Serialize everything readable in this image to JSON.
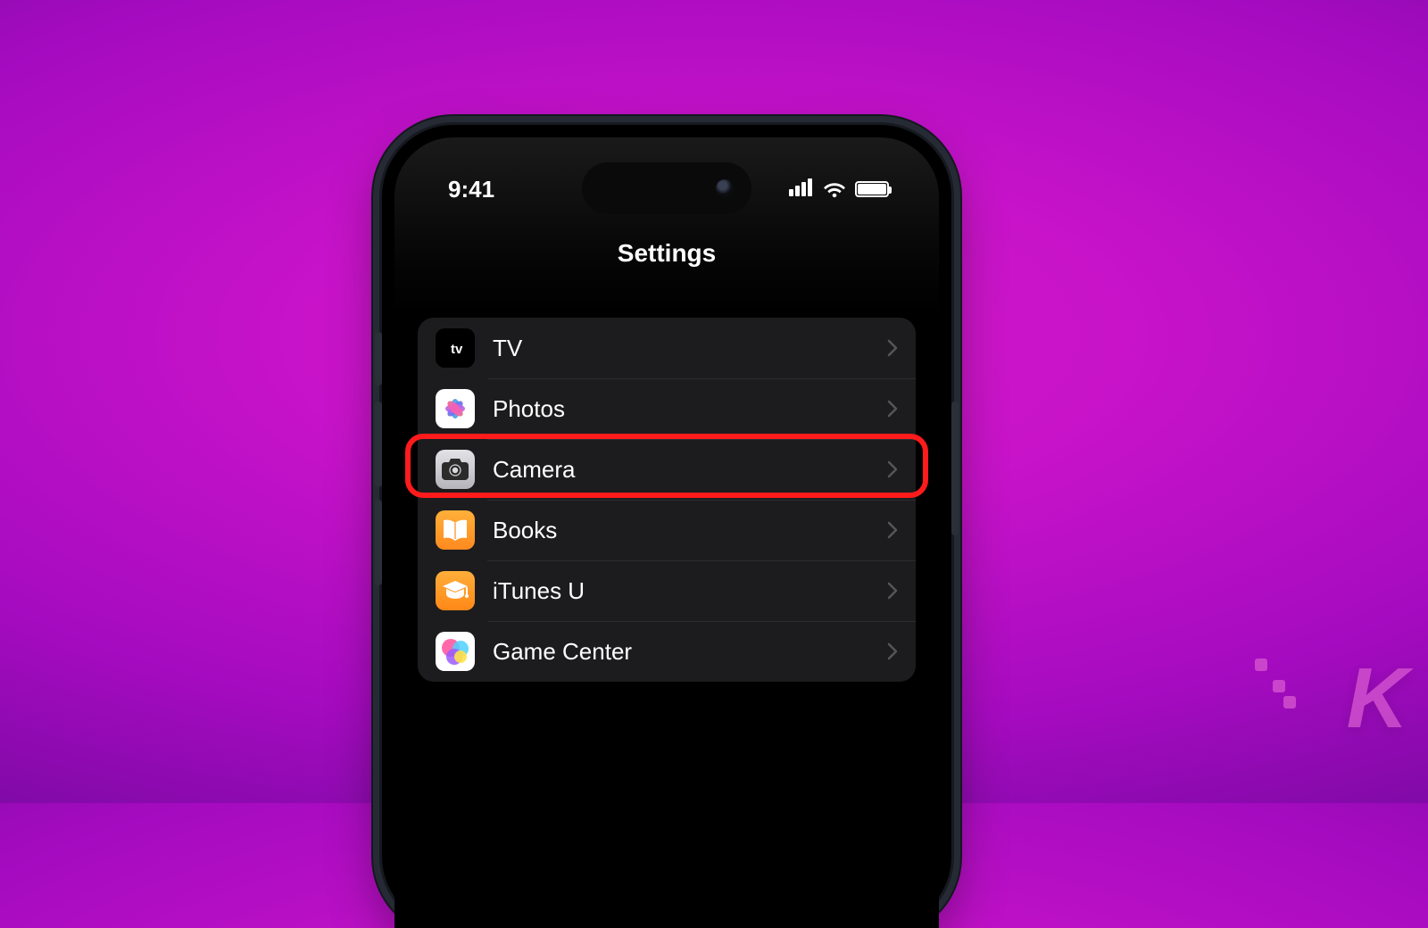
{
  "status": {
    "time": "9:41"
  },
  "header": {
    "title": "Settings"
  },
  "rows": [
    {
      "label": "TV",
      "icon": "appletv-icon"
    },
    {
      "label": "Photos",
      "icon": "photos-icon"
    },
    {
      "label": "Camera",
      "icon": "camera-icon",
      "highlighted": true
    },
    {
      "label": "Books",
      "icon": "books-icon"
    },
    {
      "label": "iTunes U",
      "icon": "itunesu-icon"
    },
    {
      "label": "Game Center",
      "icon": "gamecenter-icon"
    }
  ],
  "watermark": {
    "text": "K"
  }
}
